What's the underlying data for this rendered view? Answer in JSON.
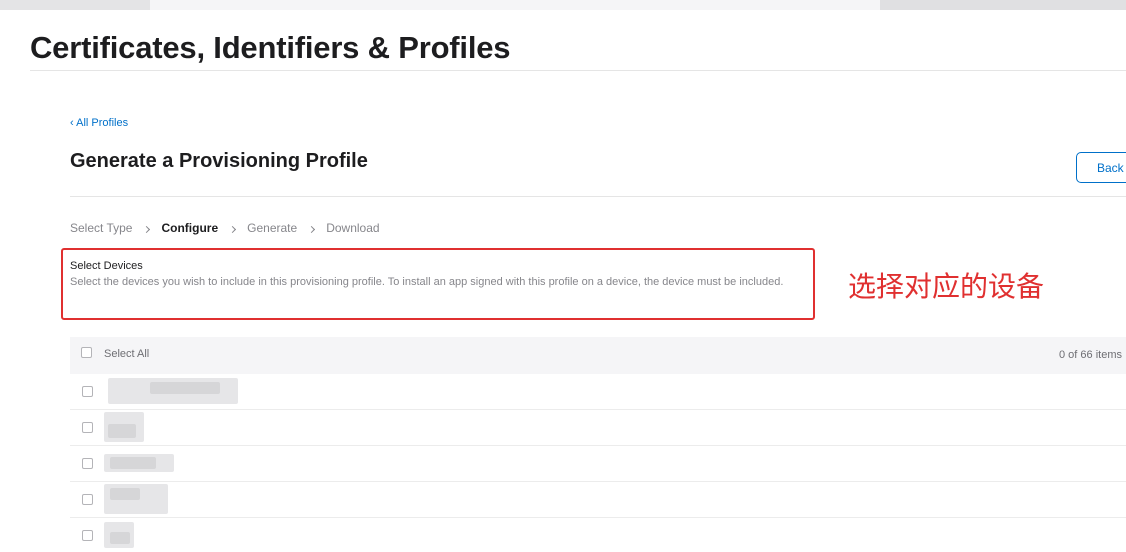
{
  "header": {
    "page_title": "Certificates, Identifiers & Profiles"
  },
  "content": {
    "back_link": "‹ All Profiles",
    "section_title": "Generate a Provisioning Profile",
    "back_button": "Back"
  },
  "steps": [
    {
      "label": "Select Type",
      "state": "done"
    },
    {
      "label": "Configure",
      "state": "active"
    },
    {
      "label": "Generate",
      "state": "pending"
    },
    {
      "label": "Download",
      "state": "pending"
    }
  ],
  "devices": {
    "heading": "Select Devices",
    "description": "Select the devices you wish to include in this provisioning profile. To install an app signed with this profile on a device, the device must be included.",
    "select_all_label": "Select All",
    "count_label": "0 of 66 items",
    "rows": [
      {
        "name": "",
        "checked": false
      },
      {
        "name": "",
        "checked": false
      },
      {
        "name": "",
        "checked": false
      },
      {
        "name": "",
        "checked": false
      },
      {
        "name": "",
        "checked": false
      }
    ]
  },
  "annotation": {
    "text": "选择对应的设备",
    "color": "#e03030"
  },
  "colors": {
    "link": "#0070c9",
    "highlight_border": "#e03030",
    "header_bg": "#f5f5f7"
  }
}
